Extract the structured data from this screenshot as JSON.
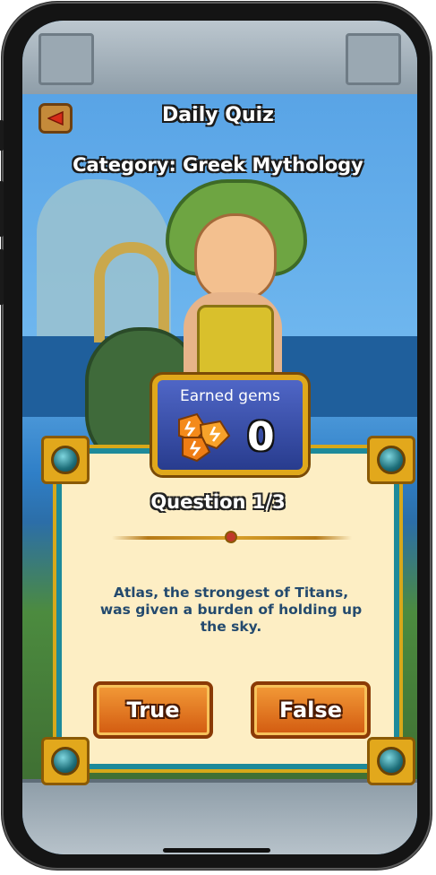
{
  "header": {
    "title": "Daily Quiz",
    "category": "Category: Greek Mythology"
  },
  "gems": {
    "label": "Earned gems",
    "count": "0"
  },
  "question": {
    "counter": "Question 1/3",
    "text": "Atlas, the strongest of Titans, was given a burden of holding up the sky."
  },
  "answers": {
    "true_label": "True",
    "false_label": "False"
  },
  "colors": {
    "panel_bg": "#fdeec4",
    "panel_border": "#1d8a9a",
    "gold": "#e2a81c",
    "button_orange": "#f39b38",
    "question_text": "#244a6e"
  },
  "icons": {
    "back": "back-arrow-icon",
    "gems": "gem-cluster-icon"
  }
}
